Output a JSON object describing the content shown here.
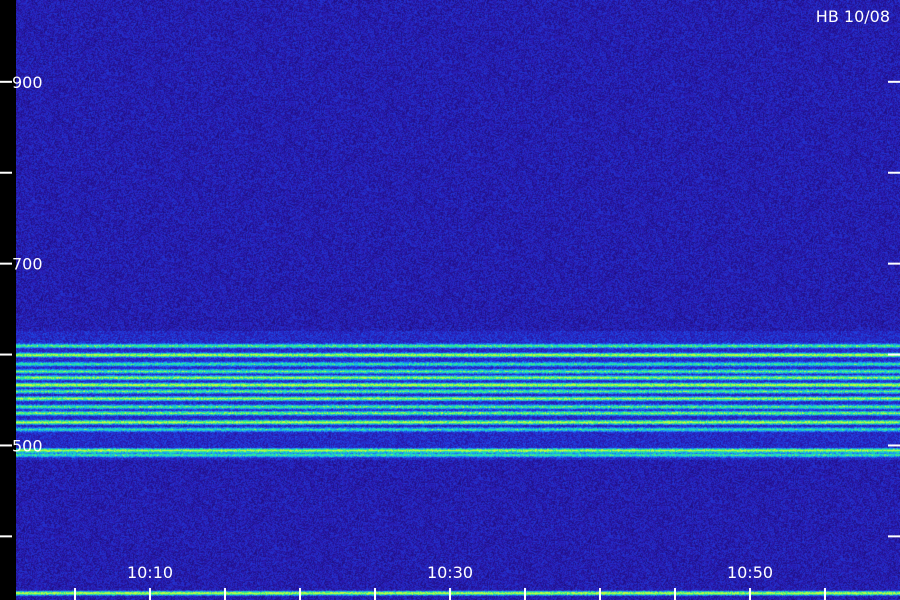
{
  "chart_data": {
    "type": "heatmap",
    "title": "",
    "corner_label": "HB 10/08",
    "xlabel": "",
    "ylabel": "",
    "y_range": [
      330,
      990
    ],
    "y_tick_labels": [
      {
        "value": 900,
        "label": "900"
      },
      {
        "value": 700,
        "label": "700"
      },
      {
        "value": 500,
        "label": "500"
      }
    ],
    "y_minor_ticks": [
      400,
      600,
      800
    ],
    "x_range": [
      "10:00",
      "11:00"
    ],
    "x_tick_labels": [
      {
        "value": "10:10",
        "label": "10:10"
      },
      {
        "value": "10:30",
        "label": "10:30"
      },
      {
        "value": "10:50",
        "label": "10:50"
      }
    ],
    "x_minor_ticks": [
      "10:05",
      "10:15",
      "10:20",
      "10:25",
      "10:35",
      "10:40",
      "10:45",
      "10:55"
    ],
    "colormap": [
      "#000030",
      "#1a0a6e",
      "#2a1ab0",
      "#1f3fe0",
      "#1c8cff",
      "#19d6c9",
      "#3cf07a",
      "#c8ff3c"
    ],
    "emission_bands": [
      {
        "freq": 610,
        "intensity": 0.62
      },
      {
        "freq": 600,
        "intensity": 0.85
      },
      {
        "freq": 590,
        "intensity": 0.55
      },
      {
        "freq": 582,
        "intensity": 0.6
      },
      {
        "freq": 575,
        "intensity": 0.75
      },
      {
        "freq": 567,
        "intensity": 0.88
      },
      {
        "freq": 560,
        "intensity": 0.6
      },
      {
        "freq": 552,
        "intensity": 0.78
      },
      {
        "freq": 543,
        "intensity": 0.62
      },
      {
        "freq": 536,
        "intensity": 0.7
      },
      {
        "freq": 526,
        "intensity": 0.82
      },
      {
        "freq": 518,
        "intensity": 0.5
      },
      {
        "freq": 495,
        "intensity": 0.8
      },
      {
        "freq": 490,
        "intensity": 0.55
      },
      {
        "freq": 338,
        "intensity": 0.95
      }
    ]
  }
}
